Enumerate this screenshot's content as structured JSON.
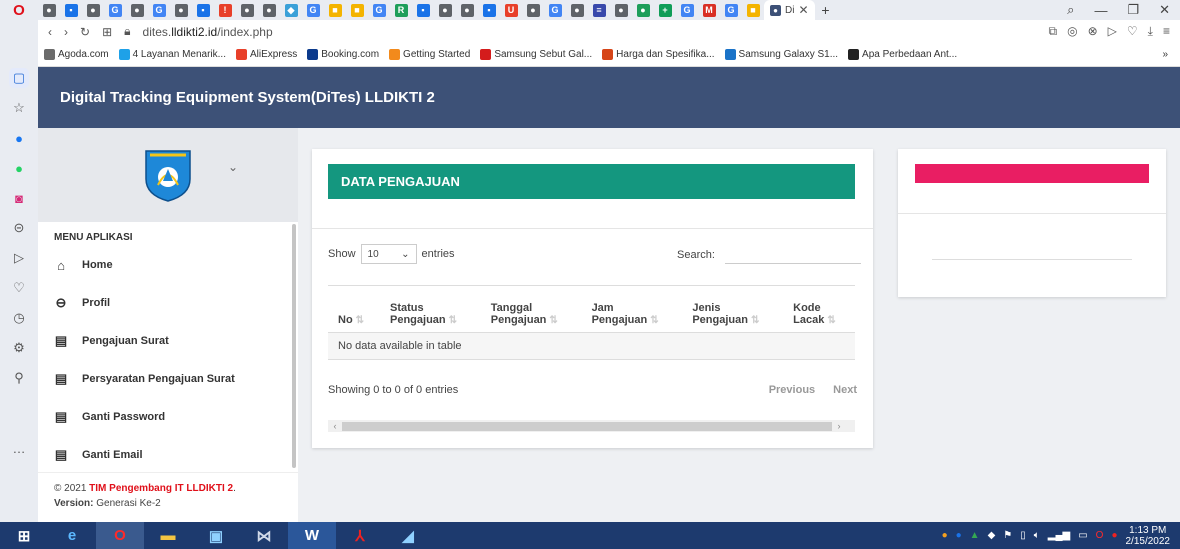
{
  "browser": {
    "active_tab_label": "Di",
    "url_prefix": "dites.",
    "url_domain": "lldikti2.id",
    "url_path": "/index.php",
    "bookmarks": [
      {
        "label": "Agoda.com",
        "color": "#6b6b6b"
      },
      {
        "label": "4 Layanan Menarik...",
        "color": "#1ea1e8"
      },
      {
        "label": "AliExpress",
        "color": "#e8402a"
      },
      {
        "label": "Booking.com",
        "color": "#0b3a8c"
      },
      {
        "label": "Getting Started",
        "color": "#f28a1c"
      },
      {
        "label": "Samsung Sebut Gal...",
        "color": "#d41c1c"
      },
      {
        "label": "Harga dan Spesifika...",
        "color": "#d64518"
      },
      {
        "label": "Samsung Galaxy S1...",
        "color": "#1a73c8"
      },
      {
        "label": "Apa Perbedaan Ant...",
        "color": "#222222"
      }
    ]
  },
  "app": {
    "title": "Digital Tracking Equipment System(DiTes) LLDIKTI 2",
    "header_color": "#3d5177"
  },
  "sidebar": {
    "menu_title": "MENU APLIKASI",
    "items": [
      {
        "label": "Home",
        "icon": "home-icon"
      },
      {
        "label": "Profil",
        "icon": "user-circle-icon"
      },
      {
        "label": "Pengajuan Surat",
        "icon": "clipboard-icon"
      },
      {
        "label": "Persyaratan Pengajuan Surat",
        "icon": "clipboard-icon"
      },
      {
        "label": "Ganti Password",
        "icon": "clipboard-icon"
      },
      {
        "label": "Ganti Email",
        "icon": "clipboard-icon"
      }
    ],
    "footer_copyright": "© 2021 ",
    "footer_team": "TIM Pengembang IT LLDIKTI 2",
    "footer_period": ".",
    "footer_version_label": "Version:",
    "footer_version_value": " Generasi Ke-2"
  },
  "main": {
    "card_title": "DATA PENGAJUAN",
    "card_title_color": "#14977f",
    "show_label": "Show",
    "show_value": "10",
    "entries_label": "entries",
    "search_label": "Search:",
    "search_value": "",
    "columns": [
      {
        "line1": "No",
        "line2": ""
      },
      {
        "line1": "Status",
        "line2": "Pengajuan"
      },
      {
        "line1": "Tanggal",
        "line2": "Pengajuan"
      },
      {
        "line1": "Jam",
        "line2": "Pengajuan"
      },
      {
        "line1": "Jenis",
        "line2": "Pengajuan"
      },
      {
        "line1": "Kode",
        "line2": "Lacak"
      }
    ],
    "empty_message": "No data available in table",
    "info_text": "Showing 0 to 0 of 0 entries",
    "prev_label": "Previous",
    "next_label": "Next"
  },
  "right_card": {
    "bar_color": "#e91e63"
  },
  "taskbar": {
    "time": "1:13 PM",
    "date": "2/15/2022"
  }
}
